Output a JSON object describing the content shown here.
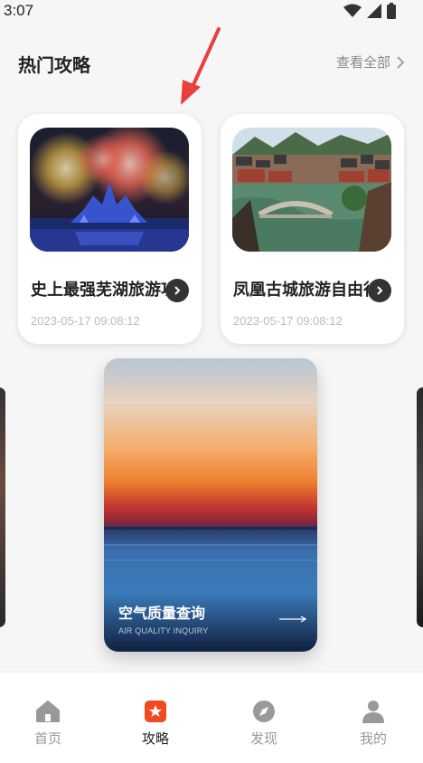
{
  "status_bar": {
    "time": "3:07"
  },
  "header": {
    "title": "热门攻略",
    "view_all": "查看全部"
  },
  "guides": [
    {
      "title": "史上最强芜湖旅游攻略",
      "date": "2023-05-17 09:08:12"
    },
    {
      "title": "凤凰古城旅游自由行攻略",
      "date": "2023-05-17 09:08:12"
    }
  ],
  "feature": {
    "title": "空气质量查询",
    "subtitle": "AIR QUALITY INQUIRY"
  },
  "nav": [
    {
      "label": "首页",
      "icon": "home-icon"
    },
    {
      "label": "攻略",
      "icon": "guide-icon"
    },
    {
      "label": "发现",
      "icon": "compass-icon"
    },
    {
      "label": "我的",
      "icon": "user-icon"
    }
  ],
  "colors": {
    "accent": "#f04a23",
    "annotation": "#e8403a",
    "background": "#f6f6f6"
  }
}
